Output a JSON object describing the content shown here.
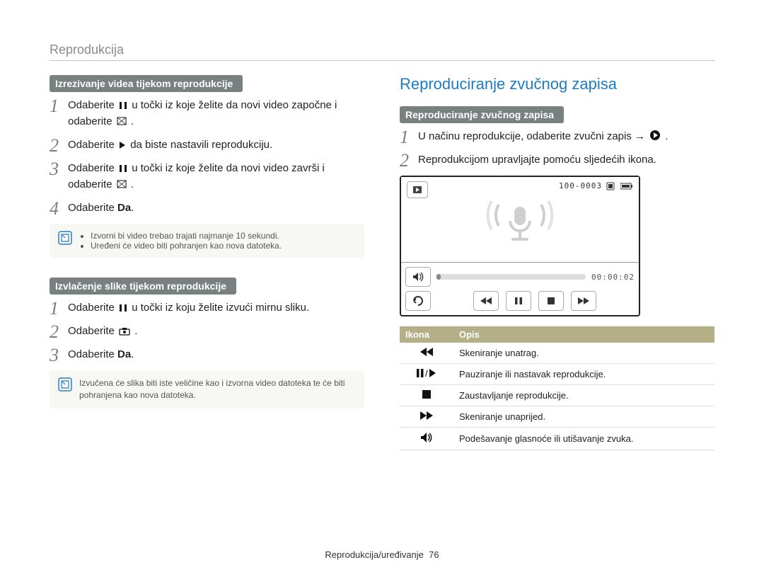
{
  "section_label": "Reprodukcija",
  "footer": "Reprodukcija/uređivanje",
  "page_number": "76",
  "left": {
    "segment1_title": "Izrezivanje videa tijekom reprodukcije",
    "steps1": {
      "s1a": "Odaberite ",
      "s1b": " u točki iz koje želite da novi video započne i odaberite ",
      "s1c": ".",
      "s2a": "Odaberite ",
      "s2b": " da biste nastavili reprodukciju.",
      "s3a": "Odaberite ",
      "s3b": " u točki iz koje želite da novi video završi i odaberite ",
      "s3c": ".",
      "s4a": "Odaberite ",
      "s4b": "Da",
      "s4c": "."
    },
    "note1": {
      "b1": "Izvorni bi video trebao trajati najmanje 10 sekundi.",
      "b2": "Uređeni će video biti pohranjen kao nova datoteka."
    },
    "segment2_title": "Izvlačenje slike tijekom reprodukcije",
    "steps2": {
      "s1a": "Odaberite ",
      "s1b": " u točki iz koju želite izvući mirnu sliku.",
      "s2a": "Odaberite ",
      "s2b": ".",
      "s3a": "Odaberite ",
      "s3b": "Da",
      "s3c": "."
    },
    "note2": "Izvučena će slika biti iste veličine kao i izvorna video datoteka te će biti pohranjena kao nova datoteka."
  },
  "right": {
    "heading": "Reproduciranje zvučnog zapisa",
    "segment_title": "Reproduciranje zvučnog zapisa",
    "steps": {
      "s1a": "U načinu reprodukcije, odaberite zvučni zapis → ",
      "s1b": ".",
      "s2": "Reprodukcijom upravljajte pomoću sljedećih ikona."
    },
    "player": {
      "counter": "100-0003",
      "time": "00:00:02"
    },
    "table": {
      "th_icon": "Ikona",
      "th_desc": "Opis",
      "r1": "Skeniranje unatrag.",
      "r2": "Pauziranje ili nastavak reprodukcije.",
      "r3": "Zaustavljanje reprodukcije.",
      "r4": "Skeniranje unaprijed.",
      "r5": "Podešavanje glasnoće ili utišavanje zvuka."
    }
  }
}
